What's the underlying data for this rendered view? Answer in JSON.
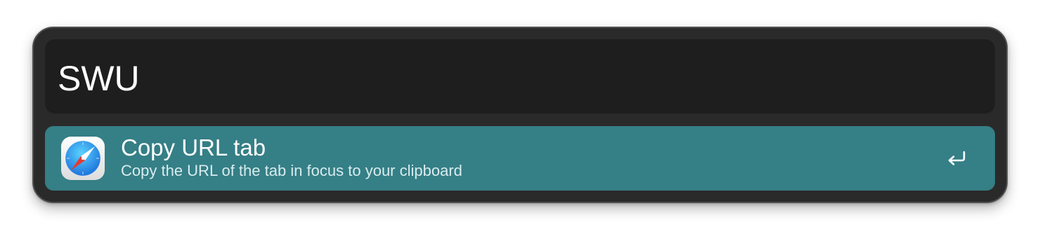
{
  "search": {
    "value": "SWU",
    "placeholder": ""
  },
  "results": [
    {
      "title": "Copy URL tab",
      "subtitle": "Copy the URL of the tab in focus to your clipboard",
      "icon": "safari-compass-icon",
      "action_icon": "return-key-icon",
      "selected": true
    }
  ],
  "colors": {
    "window_bg": "#2a2a2a",
    "search_bg": "#1e1e1e",
    "selected_row": "#357f86",
    "text_primary": "#ffffff",
    "text_secondary": "#d8ecee"
  }
}
